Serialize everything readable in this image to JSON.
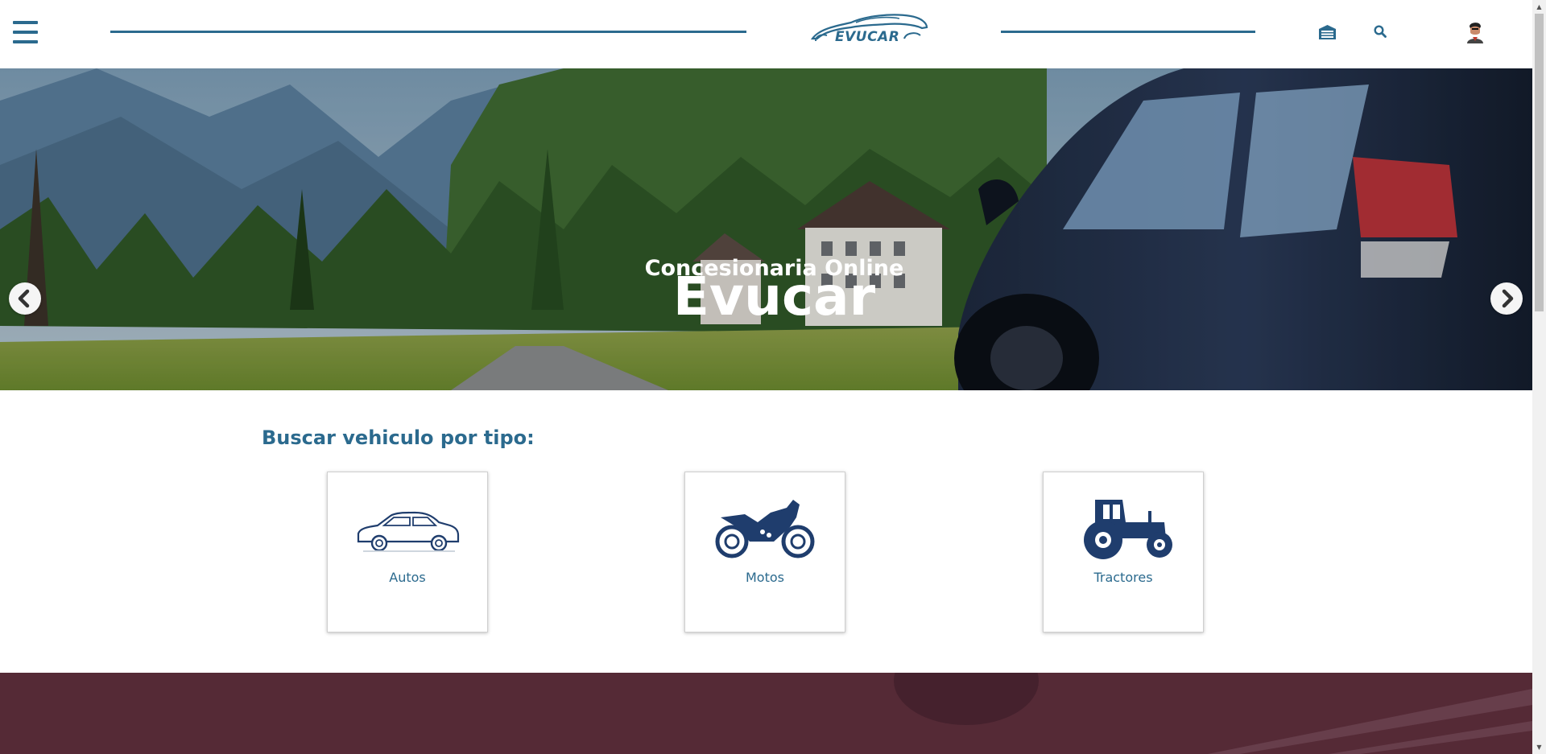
{
  "header": {
    "logo_text": "EVUCAR",
    "menu_icon": "hamburger-menu-icon",
    "garage_icon": "garage-icon",
    "search_icon": "search-icon",
    "avatar_icon": "user-avatar",
    "accent_color": "#2b6a8e"
  },
  "hero": {
    "subtitle": "Concesionaria Online",
    "title": "Evucar",
    "prev_icon": "chevron-left-icon",
    "next_icon": "chevron-right-icon"
  },
  "search_section": {
    "title": "Buscar vehiculo por tipo:",
    "types": [
      {
        "label": "Autos",
        "icon": "car-icon"
      },
      {
        "label": "Motos",
        "icon": "motorcycle-icon"
      },
      {
        "label": "Tractores",
        "icon": "tractor-icon"
      }
    ]
  }
}
